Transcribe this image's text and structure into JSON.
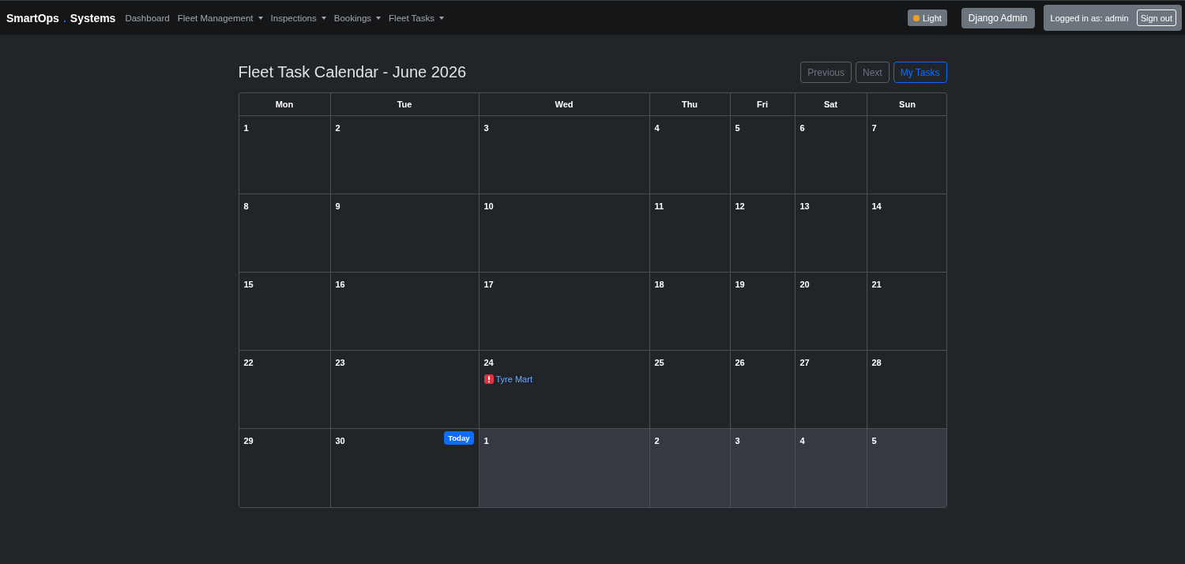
{
  "navbar": {
    "brand": {
      "name": "SmartOps",
      "separator": ".",
      "suffix": "Systems"
    },
    "links": [
      {
        "label": "Dashboard",
        "dropdown": false
      },
      {
        "label": "Fleet Management",
        "dropdown": true
      },
      {
        "label": "Inspections",
        "dropdown": true
      },
      {
        "label": "Bookings",
        "dropdown": true
      },
      {
        "label": "Fleet Tasks",
        "dropdown": true
      }
    ],
    "theme_toggle": {
      "label": "Light"
    },
    "admin_button": "Django Admin",
    "user": {
      "text": "Logged in as: admin",
      "sign_out": "Sign out"
    }
  },
  "page": {
    "title": "Fleet Task Calendar - June 2026",
    "buttons": [
      {
        "label": "Previous",
        "kind": "secondary"
      },
      {
        "label": "Next",
        "kind": "secondary"
      },
      {
        "label": "My Tasks",
        "kind": "primary"
      }
    ]
  },
  "calendar": {
    "weekdays": [
      "Mon",
      "Tue",
      "Wed",
      "Thu",
      "Fri",
      "Sat",
      "Sun"
    ],
    "weeks": [
      {
        "days": [
          {
            "day": "1",
            "other_month": false
          },
          {
            "day": "2",
            "other_month": false
          },
          {
            "day": "3",
            "other_month": false
          },
          {
            "day": "4",
            "other_month": false
          },
          {
            "day": "5",
            "other_month": false
          },
          {
            "day": "6",
            "other_month": false
          },
          {
            "day": "7",
            "other_month": false
          }
        ]
      },
      {
        "days": [
          {
            "day": "8",
            "other_month": false
          },
          {
            "day": "9",
            "other_month": false
          },
          {
            "day": "10",
            "other_month": false
          },
          {
            "day": "11",
            "other_month": false
          },
          {
            "day": "12",
            "other_month": false
          },
          {
            "day": "13",
            "other_month": false
          },
          {
            "day": "14",
            "other_month": false
          }
        ]
      },
      {
        "days": [
          {
            "day": "15",
            "other_month": false
          },
          {
            "day": "16",
            "other_month": false
          },
          {
            "day": "17",
            "other_month": false
          },
          {
            "day": "18",
            "other_month": false
          },
          {
            "day": "19",
            "other_month": false
          },
          {
            "day": "20",
            "other_month": false
          },
          {
            "day": "21",
            "other_month": false
          }
        ]
      },
      {
        "days": [
          {
            "day": "22",
            "other_month": false
          },
          {
            "day": "23",
            "other_month": false
          },
          {
            "day": "24",
            "other_month": false,
            "events": [
              {
                "title": "Tyre Mart",
                "kind": "alert"
              }
            ]
          },
          {
            "day": "25",
            "other_month": false
          },
          {
            "day": "26",
            "other_month": false
          },
          {
            "day": "27",
            "other_month": false
          },
          {
            "day": "28",
            "other_month": false
          }
        ]
      },
      {
        "days": [
          {
            "day": "29",
            "other_month": false
          },
          {
            "day": "30",
            "other_month": false,
            "badge": "Today"
          },
          {
            "day": "1",
            "other_month": true
          },
          {
            "day": "2",
            "other_month": true
          },
          {
            "day": "3",
            "other_month": true
          },
          {
            "day": "4",
            "other_month": true
          },
          {
            "day": "5",
            "other_month": true
          }
        ]
      }
    ]
  }
}
